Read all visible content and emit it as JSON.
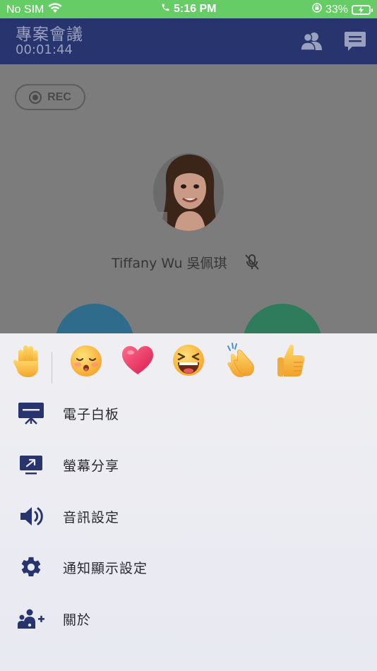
{
  "status_bar": {
    "carrier": "No SIM",
    "time": "5:16 PM",
    "battery": "33%"
  },
  "header": {
    "title": "專案會議",
    "timer": "00:01:44"
  },
  "content": {
    "rec_label": "REC",
    "participant_name": "Tiffany Wu 吳佩琪"
  },
  "reactions": [
    {
      "name": "raised-hand",
      "glyph": "✋"
    },
    {
      "name": "relieved-face",
      "glyph": "😌"
    },
    {
      "name": "heart",
      "glyph": "❤"
    },
    {
      "name": "laughing-face",
      "glyph": "😆"
    },
    {
      "name": "clapping-hands",
      "glyph": "👏"
    },
    {
      "name": "thumbs-up",
      "glyph": "👍"
    }
  ],
  "menu": {
    "whiteboard": "電子白板",
    "screen_share": "螢幕分享",
    "audio_settings": "音訊設定",
    "notification_settings": "通知顯示設定",
    "about": "關於"
  },
  "colors": {
    "status_bar": "#66cc66",
    "header": "#27346e",
    "dim_overlay": "#7c7c7c",
    "menu_icon": "#27346e",
    "button_blue": "#2f6b8a",
    "button_green": "#2e7c5c"
  }
}
